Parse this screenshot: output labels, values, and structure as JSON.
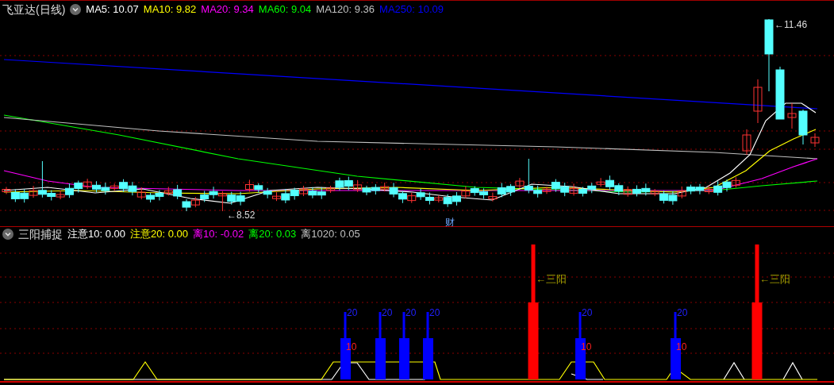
{
  "main_legend": {
    "title": "飞亚达(日线)",
    "items": [
      {
        "label": "MA5: 10.07",
        "color": "#ffffff"
      },
      {
        "label": "MA10: 9.82",
        "color": "#ffff00"
      },
      {
        "label": "MA20: 9.34",
        "color": "#ff00ff"
      },
      {
        "label": "MA60: 9.04",
        "color": "#00ff00"
      },
      {
        "label": "MA120: 9.36",
        "color": "#c0c0c0"
      },
      {
        "label": "MA250: 10.09",
        "color": "#0000ff"
      }
    ]
  },
  "price_labels": {
    "high": "←11.46",
    "low": "←8.52",
    "event_marker": "财"
  },
  "indicator_legend": {
    "title": "三阳捕捉",
    "items": [
      {
        "label": "注意10: 0.00",
        "color": "#ffffff"
      },
      {
        "label": "注意20: 0.00",
        "color": "#ffff00"
      },
      {
        "label": "离10: -0.02",
        "color": "#ff00ff"
      },
      {
        "label": "离20: 0.03",
        "color": "#00ff00"
      },
      {
        "label": "离1020: 0.05",
        "color": "#c0c0c0"
      }
    ]
  },
  "signals": [
    {
      "kind": "blue",
      "upper_label": "20",
      "lower_label": "10"
    },
    {
      "kind": "blue",
      "upper_label": "20"
    },
    {
      "kind": "blue",
      "upper_label": "20"
    },
    {
      "kind": "blue",
      "upper_label": "20"
    },
    {
      "kind": "red",
      "label": "←三阳"
    },
    {
      "kind": "blue",
      "upper_label": "20",
      "lower_label": "10"
    },
    {
      "kind": "blue",
      "upper_label": "20",
      "lower_label": "10"
    },
    {
      "kind": "red",
      "label": "←三阳"
    }
  ]
}
